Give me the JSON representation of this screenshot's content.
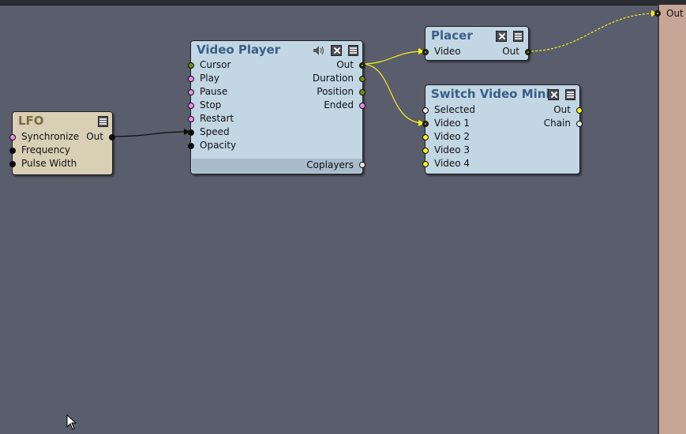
{
  "canvas": {
    "background": "#5a5d6b",
    "right_panel_color": "#c8a696"
  },
  "output_port": {
    "label": "Out"
  },
  "nodes": {
    "lfo": {
      "title": "LFO",
      "inputs": [
        "Synchronize",
        "Frequency",
        "Pulse Width"
      ],
      "outputs": [
        "Out"
      ]
    },
    "video_player": {
      "title": "Video Player",
      "inputs": [
        "Cursor",
        "Play",
        "Pause",
        "Stop",
        "Restart",
        "Speed",
        "Opacity"
      ],
      "outputs": [
        "Out",
        "Duration",
        "Position",
        "Ended"
      ],
      "footer_output": "Coplayers"
    },
    "placer": {
      "title": "Placer",
      "inputs": [
        "Video"
      ],
      "outputs": [
        "Out"
      ]
    },
    "switch_video_mini": {
      "title": "Switch Video Mini",
      "inputs": [
        "Selected",
        "Video 1",
        "Video 2",
        "Video 3",
        "Video 4"
      ],
      "outputs": [
        "Out",
        "Chain"
      ]
    }
  },
  "icons": {
    "speaker": "speaker-icon",
    "close": "close-icon",
    "menu": "menu-icon",
    "cursor": "mouse-cursor-icon"
  }
}
